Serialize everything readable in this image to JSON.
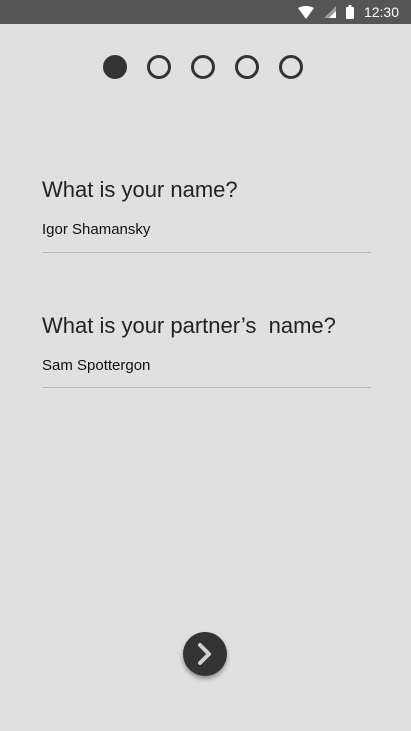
{
  "status_bar": {
    "time": "12:30",
    "icons": [
      "wifi-icon",
      "cellular-signal-icon",
      "battery-icon"
    ],
    "background_color": "#555555"
  },
  "stepper": {
    "total_steps": 5,
    "current_step": 1
  },
  "form": {
    "name_question": "What is your name?",
    "name_value": "Igor Shamansky",
    "partner_question": "What is your partner’s  name?",
    "partner_value": "Sam Spottergon"
  },
  "next_button": {
    "icon": "chevron-right-icon"
  },
  "colors": {
    "background": "#e0e0e0",
    "accent": "#333333"
  }
}
